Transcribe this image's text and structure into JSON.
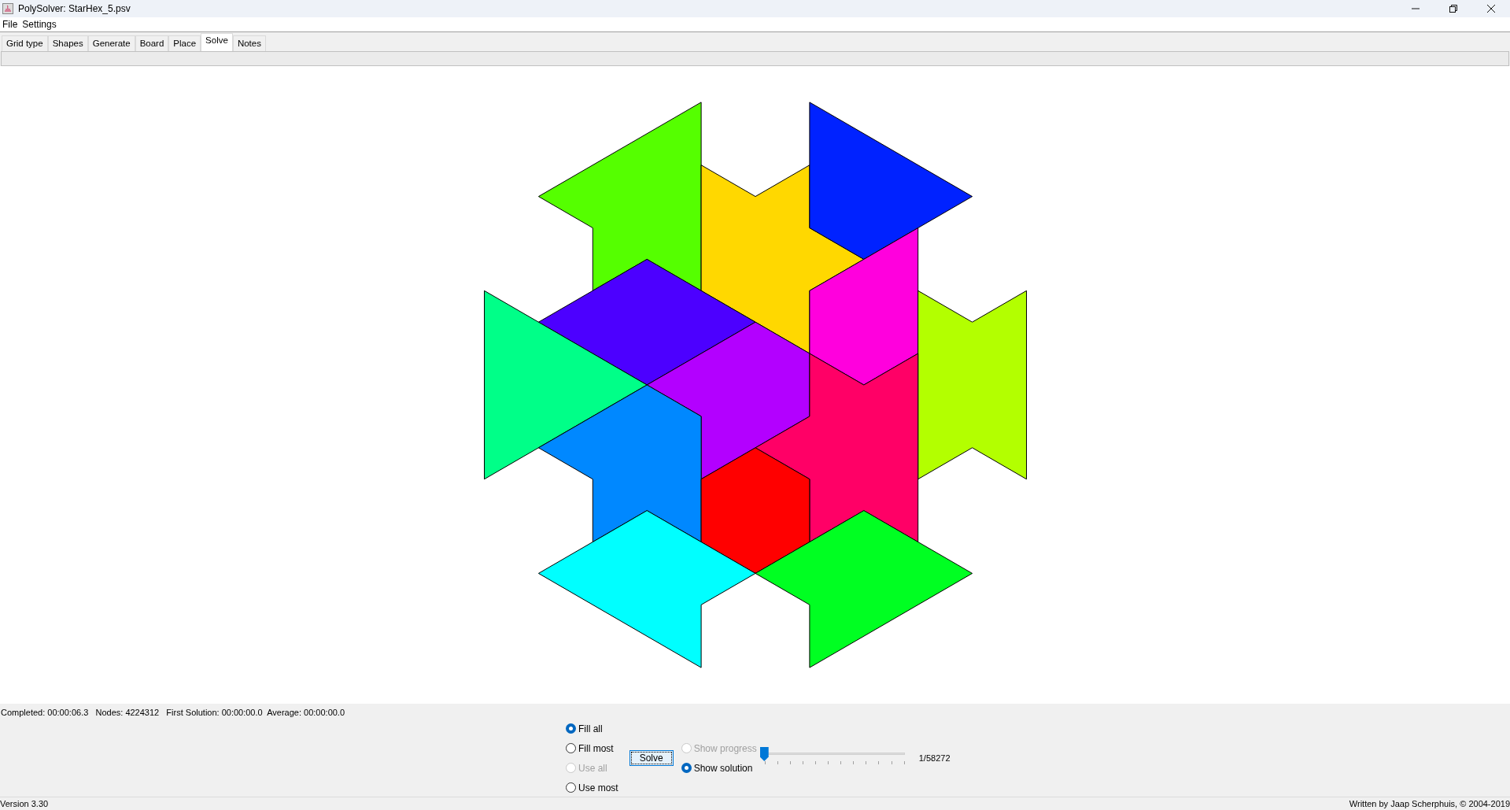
{
  "window": {
    "title": "PolySolver: StarHex_5.psv"
  },
  "menu": [
    "File",
    "Settings"
  ],
  "tabs": [
    {
      "label": "Grid type",
      "selected": false
    },
    {
      "label": "Shapes",
      "selected": false
    },
    {
      "label": "Generate",
      "selected": false
    },
    {
      "label": "Board",
      "selected": false
    },
    {
      "label": "Place",
      "selected": false
    },
    {
      "label": "Solve",
      "selected": true
    },
    {
      "label": "Notes",
      "selected": false
    }
  ],
  "progress_bar": {
    "level": 0
  },
  "pieces": [
    {
      "color": "#55ff00"
    },
    {
      "color": "#ffd800"
    },
    {
      "color": "#0022ff"
    },
    {
      "color": "#ff00dd"
    },
    {
      "color": "#b3ff00"
    },
    {
      "color": "#4c00ff"
    },
    {
      "color": "#00ff88"
    },
    {
      "color": "#b300ff"
    },
    {
      "color": "#0088ff"
    },
    {
      "color": "#ff0066"
    },
    {
      "color": "#ff0000"
    },
    {
      "color": "#00ffff"
    },
    {
      "color": "#00ff22"
    }
  ],
  "status": "Completed: 00:00:06.3   Nodes: 4224312   First Solution: 00:00:00.0  Average: 00:00:00.0",
  "fill_options": [
    {
      "label": "Fill all",
      "selected": true,
      "disabled": false
    },
    {
      "label": "Fill most",
      "selected": false,
      "disabled": false
    },
    {
      "label": "Use all",
      "selected": false,
      "disabled": true
    },
    {
      "label": "Use most",
      "selected": false,
      "disabled": false
    }
  ],
  "solve_button": "Solve",
  "display_options": [
    {
      "label": "Show progress",
      "selected": false,
      "disabled": true
    },
    {
      "label": "Show solution",
      "selected": true,
      "disabled": false
    }
  ],
  "solution_slider": {
    "level": 0,
    "reading": "1/58272"
  },
  "footer": {
    "version": "Version 3.30",
    "credit": "Written by Jaap Scherphuis, © 2004-2019"
  }
}
